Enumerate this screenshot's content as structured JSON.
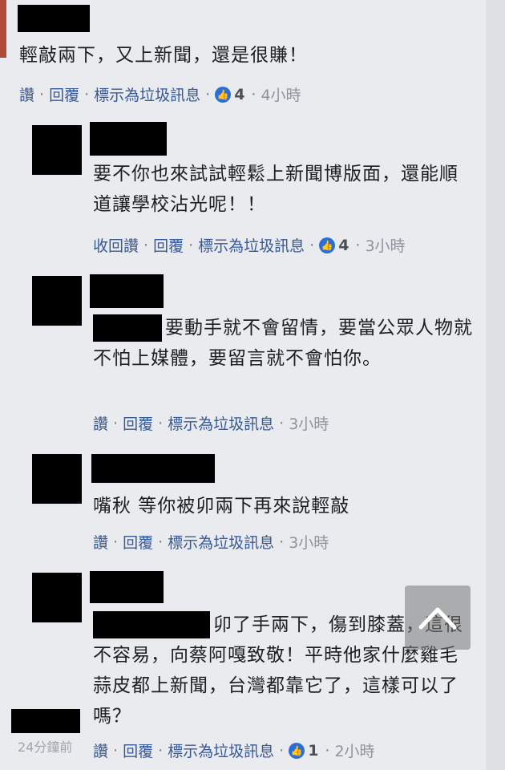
{
  "comments": [
    {
      "text": "輕敲兩下，又上新聞，還是很賺！",
      "actions": [
        "讚",
        "回覆",
        "標示為垃圾訊息"
      ],
      "likes": "4",
      "time": "4小時"
    },
    {
      "text": "要不你也來試試輕鬆上新聞博版面，還能順道讓學校沾光呢！！",
      "actions": [
        "收回讚",
        "回覆",
        "標示為垃圾訊息"
      ],
      "likes": "4",
      "time": "3小時"
    },
    {
      "text": "要動手就不會留情，要當公眾人物就不怕上媒體，要留言就不會怕你。",
      "actions": [
        "讚",
        "回覆",
        "標示為垃圾訊息"
      ],
      "time": "3小時"
    },
    {
      "text": "嘴秋 等你被卯兩下再來說輕敲",
      "actions": [
        "讚",
        "回覆",
        "標示為垃圾訊息"
      ],
      "time": "3小時"
    },
    {
      "text": "卯了手兩下，傷到膝蓋，這很不容易，向蔡阿嘎致敬！平時他家什麼雞毛蒜皮都上新聞，台灣都靠它了，這樣可以了嗎？",
      "actions": [
        "讚",
        "回覆",
        "標示為垃圾訊息"
      ],
      "likes": "1",
      "time": "2小時"
    }
  ],
  "floating_timestamp": "24分鐘前",
  "icons": {
    "like": "thumbs-up-icon",
    "scroll_top": "chevron-up-icon"
  },
  "colors": {
    "action_link": "#365899",
    "background": "#e9ebee",
    "like_badge": "#2b6fd6"
  }
}
